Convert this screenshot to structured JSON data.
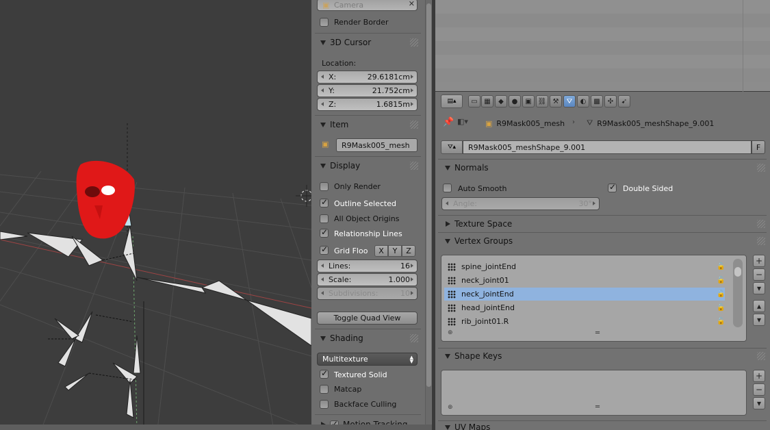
{
  "npanel": {
    "camera": {
      "label": "Camera"
    },
    "render_border": {
      "label": "Render Border",
      "checked": false
    },
    "cursor_section": {
      "title": "3D Cursor",
      "location_label": "Location:",
      "x": {
        "label": "X:",
        "value": "29.6181cm"
      },
      "y": {
        "label": "Y:",
        "value": "21.752cm"
      },
      "z": {
        "label": "Z:",
        "value": "1.6815m"
      }
    },
    "item_section": {
      "title": "Item",
      "name": "R9Mask005_mesh"
    },
    "display_section": {
      "title": "Display",
      "only_render": "Only Render",
      "outline_selected": "Outline Selected",
      "all_object_origins": "All Object Origins",
      "relationship_lines": "Relationship Lines",
      "grid_floor": "Grid Floo",
      "axis_x": "X",
      "axis_y": "Y",
      "axis_z": "Z",
      "lines": {
        "label": "Lines:",
        "value": "16"
      },
      "scale": {
        "label": "Scale:",
        "value": "1.000"
      },
      "subdivisions": {
        "label": "Subdivisions:",
        "value": "10"
      },
      "toggle_quad_view": "Toggle Quad View"
    },
    "shading_section": {
      "title": "Shading",
      "mode": "Multitexture",
      "textured_solid": "Textured Solid",
      "matcap": "Matcap",
      "backface_culling": "Backface Culling"
    },
    "motion_tracking": "Motion Tracking"
  },
  "props": {
    "breadcrumb": {
      "object": "R9Mask005_mesh",
      "mesh": "R9Mask005_meshShape_9.001"
    },
    "datablock": {
      "name": "R9Mask005_meshShape_9.001",
      "fake_user": "F"
    },
    "normals": {
      "title": "Normals",
      "auto_smooth": "Auto Smooth",
      "double_sided": "Double Sided",
      "angle": {
        "label": "Angle:",
        "value": "30°"
      }
    },
    "texture_space": {
      "title": "Texture Space"
    },
    "vertex_groups": {
      "title": "Vertex Groups",
      "items": [
        "spine_jointEnd",
        "neck_joint01",
        "neck_jointEnd",
        "head_jointEnd",
        "rib_joint01.R"
      ],
      "selected": "neck_jointEnd"
    },
    "shape_keys": {
      "title": "Shape Keys"
    },
    "uv_maps": {
      "title": "UV Maps"
    }
  },
  "colors": {
    "selection": "#8fb3df",
    "mask": "#e01818",
    "viewport_bg": "#3d3d3d"
  }
}
